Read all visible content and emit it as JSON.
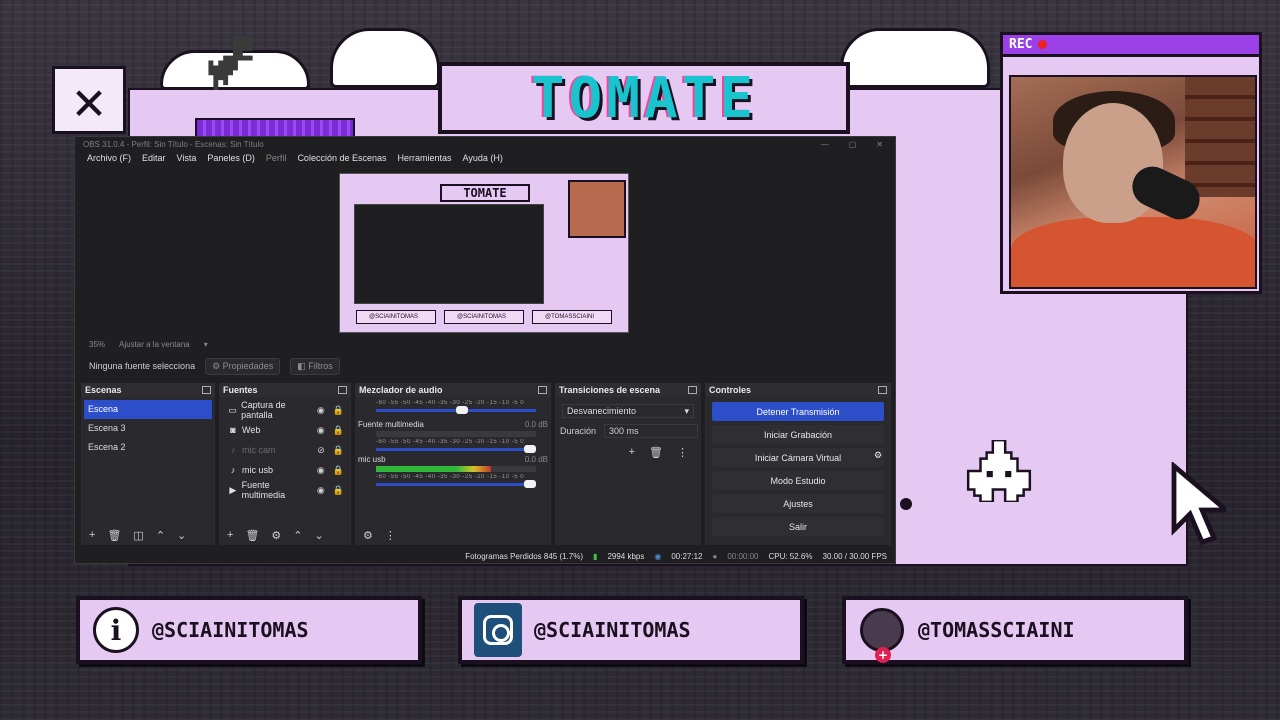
{
  "overlay": {
    "title": "TOMATE",
    "close_glyph": "✕",
    "rec_label": "REC",
    "colors": {
      "lilac": "#e6c9f2",
      "title_cyan": "#19c4cf",
      "rec_purple": "#9b3fe6",
      "obs_blue": "#2d4ec9"
    }
  },
  "socials": [
    {
      "icon": "info-icon",
      "handle": "@SCIAINITOMAS"
    },
    {
      "icon": "instagram-icon",
      "handle": "@SCIAINITOMAS"
    },
    {
      "icon": "user-avatar-icon",
      "handle": "@TOMASSCIAINI"
    }
  ],
  "obs": {
    "window_title": "OBS 31.0.4 - Perfil: Sin Título - Escenas: Sin Título",
    "menu": [
      "Archivo (F)",
      "Editar",
      "Vista",
      "Paneles (D)",
      "Perfil",
      "Colección de Escenas",
      "Herramientas",
      "Ayuda (H)"
    ],
    "preview_zoom": "35%",
    "preview_fit": "Ajustar a la ventana",
    "no_source": "Ninguna fuente selecciona",
    "properties_btn": "Propiedades",
    "filters_btn": "Filtros",
    "docks": {
      "scenes": {
        "title": "Escenas",
        "items": [
          "Escena",
          "Escena 3",
          "Escena 2"
        ],
        "active_index": 0
      },
      "sources": {
        "title": "Fuentes",
        "items": [
          {
            "label": "Captura de pantalla",
            "icon": "monitor-icon",
            "visible": true
          },
          {
            "label": "Web",
            "icon": "camera-icon",
            "visible": true
          },
          {
            "label": "mic cam",
            "icon": "mic-icon",
            "visible": false
          },
          {
            "label": "mic usb",
            "icon": "mic-icon",
            "visible": true
          },
          {
            "label": "Fuente multimedia",
            "icon": "play-icon",
            "visible": true
          }
        ]
      },
      "mixer": {
        "title": "Mezclador de audio",
        "scale": "-60 -55 -50 -45 -40 -35 -30 -25 -20 -15 -10 -5 0",
        "tracks": [
          {
            "name": "Fuente multimedia",
            "db": "0.0 dB",
            "level": 0.0,
            "volume": 1.0
          },
          {
            "name": "mic usb",
            "db": "0.0 dB",
            "level": 0.72,
            "volume": 1.0
          }
        ]
      },
      "transitions": {
        "title": "Transiciones de escena",
        "selected": "Desvanecimiento",
        "duration_label": "Duración",
        "duration_value": "300 ms"
      },
      "controls": {
        "title": "Controles",
        "buttons": [
          "Detener Transmisión",
          "Iniciar Grabación",
          "Iniciar Cámara Virtual",
          "Modo Estudio",
          "Ajustes",
          "Salir"
        ]
      }
    },
    "status": {
      "dropped": "Fotogramas Perdidos 845 (1.7%)",
      "bitrate": "2994 kbps",
      "stream_time": "00:27:12",
      "rec_time": "00:00:00",
      "cpu": "CPU: 52.6%",
      "fps": "30.00 / 30.00 FPS"
    }
  }
}
